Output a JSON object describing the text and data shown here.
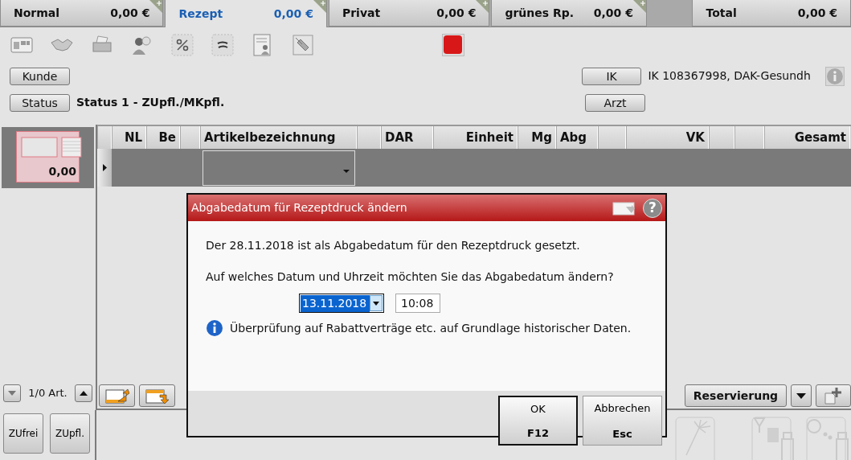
{
  "tabs": [
    {
      "label": "Normal",
      "amount": "0,00 €",
      "selected": false,
      "addable": true
    },
    {
      "label": "Rezept",
      "amount": "0,00 €",
      "selected": true,
      "addable": true
    },
    {
      "label": "Privat",
      "amount": "0,00 €",
      "selected": false,
      "addable": true
    },
    {
      "label": "grünes Rp.",
      "amount": "0,00 €",
      "selected": false,
      "addable": true
    },
    {
      "label": "Total",
      "amount": "0,00 €",
      "selected": false,
      "addable": false
    }
  ],
  "customer": {
    "button": "Kunde"
  },
  "status": {
    "button": "Status",
    "text": "Status 1 - ZUpfl./MKpfl."
  },
  "insurance": {
    "button": "IK",
    "text": "IK 108367998, DAK-Gesundh"
  },
  "doctor": {
    "button": "Arzt"
  },
  "receipt_card": {
    "amount": "0,00"
  },
  "table": {
    "columns": [
      {
        "kind": "blank"
      },
      {
        "kind": "text",
        "label": "NL"
      },
      {
        "kind": "text",
        "label": "Be"
      },
      {
        "kind": "blank"
      },
      {
        "kind": "text",
        "label": "Artikelbezeichnung"
      },
      {
        "kind": "blank"
      },
      {
        "kind": "text",
        "label": "DAR"
      },
      {
        "kind": "text",
        "label": "Einheit"
      },
      {
        "kind": "text",
        "label": "Mg"
      },
      {
        "kind": "text",
        "label": "Abg"
      },
      {
        "kind": "blank"
      },
      {
        "kind": "text",
        "label": "VK"
      },
      {
        "kind": "blank"
      },
      {
        "kind": "blank"
      },
      {
        "kind": "text",
        "label": "Gesamt"
      }
    ]
  },
  "pager": {
    "text": "1/0 Art."
  },
  "reservation": {
    "button": "Reservierung"
  },
  "quick_buttons": [
    "ZUfrei",
    "ZUpfl."
  ],
  "dialog": {
    "title": "Abgabedatum für Rezeptdruck ändern",
    "help": "?",
    "message": "Der 28.11.2018 ist als Abgabedatum für den Rezeptdruck gesetzt.",
    "question": "Auf welches Datum und Uhrzeit möchten Sie das Abgabedatum ändern?",
    "date": "13.11.2018",
    "date_highlighted": true,
    "time": "10:08",
    "info": "Überprüfung auf Rabattverträge etc. auf Grundlage historischer Daten.",
    "buttons": [
      {
        "label": "OK",
        "key": "F12",
        "default": true
      },
      {
        "label": "Abbrechen",
        "key": "Esc",
        "default": false
      }
    ]
  }
}
